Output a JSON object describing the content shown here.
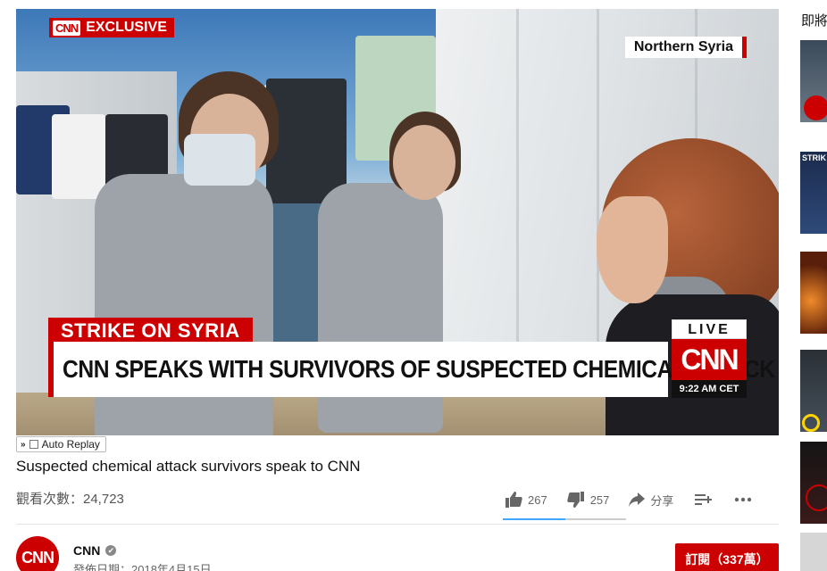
{
  "player": {
    "exclusive_logo": "CNN",
    "exclusive_label": "EXCLUSIVE",
    "location": "Northern Syria",
    "strike_label": "STRIKE ON SYRIA",
    "headline": "CNN SPEAKS WITH SURVIVORS OF SUSPECTED CHEMICAL ATTACK",
    "live_label": "LIVE",
    "logo_text": "CNN",
    "clock": "9:22 AM CET"
  },
  "auto_replay": {
    "label": "Auto Replay",
    "checked": false
  },
  "video": {
    "title": "Suspected chemical attack survivors speak to CNN",
    "views": "觀看次數：24,723"
  },
  "actions": {
    "likes": "267",
    "dislikes": "257",
    "share_label": "分享",
    "like_ratio": 0.51
  },
  "channel": {
    "avatar_text": "CNN",
    "name": "CNN",
    "published": "發佈日期：2018年4月15日",
    "subscribe_label": "訂閱（337萬）"
  },
  "sidebar": {
    "up_next_label": "即將",
    "thumb2_label": "STRIK"
  },
  "colors": {
    "brand_red": "#cc0000",
    "like_bar": "#3ea6ff"
  }
}
